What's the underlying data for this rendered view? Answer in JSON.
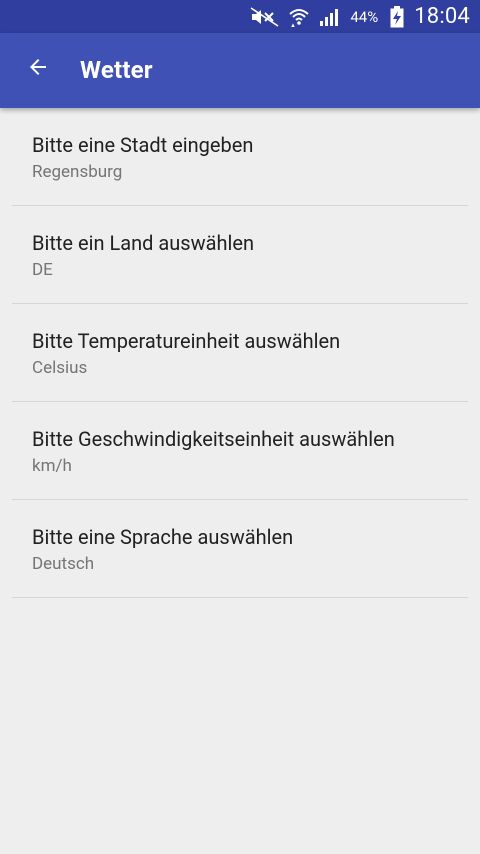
{
  "status_bar": {
    "battery_percent": "44%",
    "time": "18:04",
    "icons": [
      "mute-icon",
      "wifi-icon",
      "signal-icon",
      "battery-charging-icon"
    ]
  },
  "app_bar": {
    "title": "Wetter",
    "back_icon": "arrow-left-icon",
    "color": "#3F51B5",
    "status_color": "#303F9F"
  },
  "preferences": [
    {
      "title": "Bitte eine Stadt eingeben",
      "summary": "Regensburg"
    },
    {
      "title": "Bitte ein Land auswählen",
      "summary": "DE"
    },
    {
      "title": "Bitte Temperatureinheit auswählen",
      "summary": "Celsius"
    },
    {
      "title": "Bitte Geschwindigkeitseinheit auswählen",
      "summary": "km/h"
    },
    {
      "title": "Bitte eine Sprache auswählen",
      "summary": "Deutsch"
    }
  ]
}
